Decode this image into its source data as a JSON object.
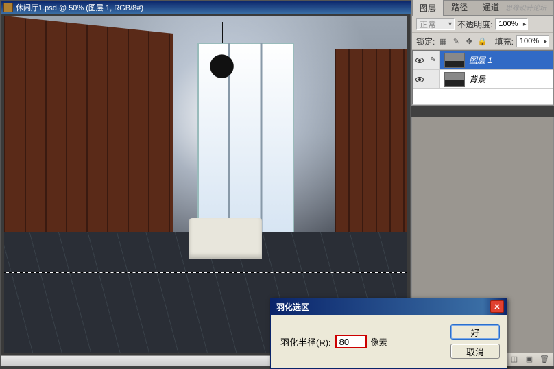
{
  "document": {
    "title": "休闲厅1.psd @ 50% (图层 1, RGB/8#)"
  },
  "layers_panel": {
    "tabs": {
      "layers": "图层",
      "paths": "路径",
      "channels": "通道"
    },
    "blend_mode": "正常",
    "opacity_label": "不透明度:",
    "opacity_value": "100%",
    "lock_label": "锁定:",
    "fill_label": "填充:",
    "fill_value": "100%",
    "layers": [
      {
        "name": "图层 1"
      },
      {
        "name": "背景"
      }
    ]
  },
  "watermark": "思缘设计论坛",
  "dialog": {
    "title": "羽化选区",
    "radius_label": "羽化半径(R):",
    "radius_value": "80",
    "radius_unit": "像素",
    "ok": "好",
    "cancel": "取消"
  }
}
